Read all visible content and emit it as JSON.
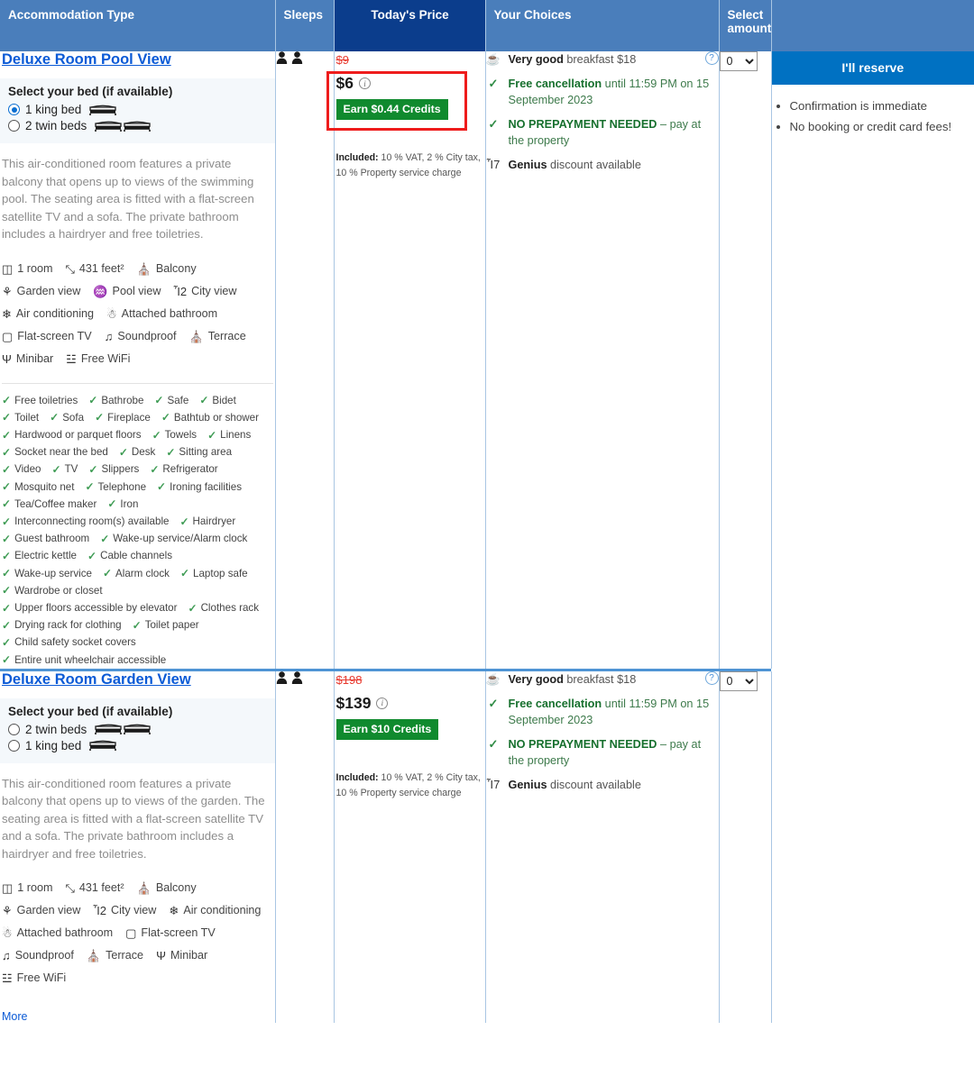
{
  "header": {
    "columns": [
      {
        "label": "Accommodation Type",
        "name": "accommodation-type"
      },
      {
        "label": "Sleeps",
        "name": "sleeps"
      },
      {
        "label": "Today's Price",
        "name": "todays-price"
      },
      {
        "label": "Your Choices",
        "name": "your-choices"
      },
      {
        "label": "Select amount",
        "name": "select-amount"
      },
      {
        "label": "",
        "name": "actions"
      }
    ],
    "accent_blue": "#4a7ebb",
    "price_header_bg": "#0b3d8c"
  },
  "rooms": [
    {
      "title": "Deluxe Room Pool View",
      "bed": {
        "heading": "Select your bed (if available)",
        "options": [
          {
            "label": "1 king bed",
            "beds": 1,
            "selected": true
          },
          {
            "label": "2 twin beds",
            "beds": 2,
            "selected": false
          }
        ]
      },
      "description": "This air-conditioned room features a private balcony that opens up to views of the swimming pool. The seating area is fitted with a flat-screen satellite TV and a sofa. The private bathroom includes a hairdryer and free toiletries.",
      "facilities": [
        [
          {
            "icon": "room-icon",
            "glyph": "◫",
            "label": "1 room"
          },
          {
            "icon": "area-size-icon",
            "glyph": "⤡",
            "label": "431 feet²"
          },
          {
            "icon": "balcony-icon",
            "glyph": "⛪",
            "label": "Balcony"
          }
        ],
        [
          {
            "icon": "garden-view-icon",
            "glyph": "⚘",
            "label": "Garden view"
          },
          {
            "icon": "pool-view-icon",
            "glyph": "♒",
            "label": "Pool view"
          },
          {
            "icon": "city-view-icon",
            "glyph": "Ἶ2",
            "label": "City view"
          }
        ],
        [
          {
            "icon": "air-conditioning-icon",
            "glyph": "❄",
            "label": "Air conditioning"
          },
          {
            "icon": "attached-bathroom-icon",
            "glyph": "☃",
            "label": "Attached bathroom"
          }
        ],
        [
          {
            "icon": "flat-screen-tv-icon",
            "glyph": "▢",
            "label": "Flat-screen TV"
          },
          {
            "icon": "soundproof-icon",
            "glyph": "♫",
            "label": "Soundproof"
          },
          {
            "icon": "terrace-icon",
            "glyph": "⛪",
            "label": "Terrace"
          }
        ],
        [
          {
            "icon": "minibar-icon",
            "glyph": "Ψ",
            "label": "Minibar"
          },
          {
            "icon": "free-wifi-icon",
            "glyph": "☳",
            "label": "Free WiFi"
          }
        ]
      ],
      "amenities": [
        [
          "Free toiletries",
          "Bathrobe",
          "Safe",
          "Bidet"
        ],
        [
          "Toilet",
          "Sofa",
          "Fireplace",
          "Bathtub or shower"
        ],
        [
          "Hardwood or parquet floors",
          "Towels",
          "Linens"
        ],
        [
          "Socket near the bed",
          "Desk",
          "Sitting area"
        ],
        [
          "Video",
          "TV",
          "Slippers",
          "Refrigerator"
        ],
        [
          "Mosquito net",
          "Telephone",
          "Ironing facilities"
        ],
        [
          "Tea/Coffee maker",
          "Iron"
        ],
        [
          "Interconnecting room(s) available",
          "Hairdryer"
        ],
        [
          "Guest bathroom",
          "Wake-up service/Alarm clock"
        ],
        [
          "Electric kettle",
          "Cable channels"
        ],
        [
          "Wake-up service",
          "Alarm clock",
          "Laptop safe"
        ],
        [
          "Wardrobe or closet"
        ],
        [
          "Upper floors accessible by elevator",
          "Clothes rack"
        ],
        [
          "Drying rack for clothing",
          "Toilet paper"
        ],
        [
          "Child safety socket covers"
        ],
        [
          "Entire unit wheelchair accessible"
        ]
      ],
      "more_label": null,
      "sleeps": 2,
      "price": {
        "old": "$9",
        "current": "$6",
        "credits": "Earn $0.44 Credits",
        "included_label": "Included:",
        "included_text": "10 % VAT, 2 % City tax, 10 % Property service charge",
        "highlighted": true
      },
      "choices": [
        {
          "icon": "breakfast-cup-icon",
          "glyph": "☕",
          "strong": "Very good",
          "rest": " breakfast $18",
          "style": "plain",
          "help": true
        },
        {
          "icon": "check-icon",
          "glyph": "✓",
          "strong": "Free cancellation",
          "rest": " until 11:59 PM on 15 September 2023",
          "style": "green",
          "help": false
        },
        {
          "icon": "check-icon",
          "glyph": "✓",
          "strong": "NO PREPAYMENT NEEDED",
          "rest": " – pay at the property",
          "style": "green",
          "help": false
        },
        {
          "icon": "tag-icon",
          "glyph": "Ἷ7",
          "strong": "Genius",
          "rest": " discount available",
          "style": "genius",
          "help": false
        }
      ],
      "select_amount": {
        "value": "0",
        "options": [
          "0",
          "1",
          "2",
          "3"
        ]
      },
      "action": {
        "button_label": "I'll reserve",
        "bullets": [
          "Confirmation is immediate",
          "No booking or credit card fees!"
        ]
      }
    },
    {
      "title": "Deluxe Room Garden View",
      "bed": {
        "heading": "Select your bed (if available)",
        "options": [
          {
            "label": "2 twin beds",
            "beds": 2,
            "selected": false
          },
          {
            "label": "1 king bed",
            "beds": 1,
            "selected": false
          }
        ]
      },
      "description": "This air-conditioned room features a private balcony that opens up to views of the garden. The seating area is fitted with a flat-screen satellite TV and a sofa. The private bathroom includes a hairdryer and free toiletries.",
      "facilities": [
        [
          {
            "icon": "room-icon",
            "glyph": "◫",
            "label": "1 room"
          },
          {
            "icon": "area-size-icon",
            "glyph": "⤡",
            "label": "431 feet²"
          },
          {
            "icon": "balcony-icon",
            "glyph": "⛪",
            "label": "Balcony"
          }
        ],
        [
          {
            "icon": "garden-view-icon",
            "glyph": "⚘",
            "label": "Garden view"
          },
          {
            "icon": "city-view-icon",
            "glyph": "Ἶ2",
            "label": "City view"
          },
          {
            "icon": "air-conditioning-icon",
            "glyph": "❄",
            "label": "Air conditioning"
          }
        ],
        [
          {
            "icon": "attached-bathroom-icon",
            "glyph": "☃",
            "label": "Attached bathroom"
          },
          {
            "icon": "flat-screen-tv-icon",
            "glyph": "▢",
            "label": "Flat-screen TV"
          }
        ],
        [
          {
            "icon": "soundproof-icon",
            "glyph": "♫",
            "label": "Soundproof"
          },
          {
            "icon": "terrace-icon",
            "glyph": "⛪",
            "label": "Terrace"
          },
          {
            "icon": "minibar-icon",
            "glyph": "Ψ",
            "label": "Minibar"
          }
        ],
        [
          {
            "icon": "free-wifi-icon",
            "glyph": "☳",
            "label": "Free WiFi"
          }
        ]
      ],
      "amenities": [],
      "more_label": "More",
      "sleeps": 2,
      "price": {
        "old": "$198",
        "current": "$139",
        "credits": "Earn $10 Credits",
        "included_label": "Included:",
        "included_text": "10 % VAT, 2 % City tax, 10 % Property service charge",
        "highlighted": false
      },
      "choices": [
        {
          "icon": "breakfast-cup-icon",
          "glyph": "☕",
          "strong": "Very good",
          "rest": " breakfast $18",
          "style": "plain",
          "help": true
        },
        {
          "icon": "check-icon",
          "glyph": "✓",
          "strong": "Free cancellation",
          "rest": " until 11:59 PM on 15 September 2023",
          "style": "green",
          "help": false
        },
        {
          "icon": "check-icon",
          "glyph": "✓",
          "strong": "NO PREPAYMENT NEEDED",
          "rest": " – pay at the property",
          "style": "green",
          "help": false
        },
        {
          "icon": "tag-icon",
          "glyph": "Ἷ7",
          "strong": "Genius",
          "rest": " discount available",
          "style": "genius",
          "help": false
        }
      ],
      "select_amount": {
        "value": "0",
        "options": [
          "0",
          "1",
          "2",
          "3"
        ]
      },
      "action": null
    }
  ]
}
